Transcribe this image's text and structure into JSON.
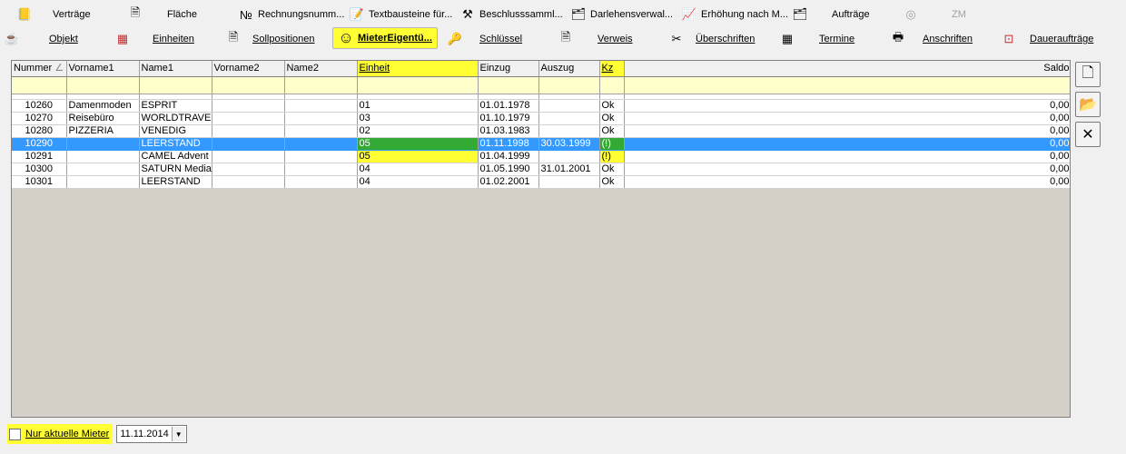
{
  "toolbar": {
    "row1": [
      {
        "label": "Verträge",
        "icon": "contract-icon",
        "glyph": "📒"
      },
      {
        "label": "Fläche",
        "icon": "area-icon",
        "glyph": "🗎"
      },
      {
        "label": "Rechnungsnumm...",
        "icon": "invoice-number-icon",
        "glyph": "№"
      },
      {
        "label": "Textbausteine für...",
        "icon": "text-blocks-icon",
        "glyph": "📝"
      },
      {
        "label": "Beschlusssamml...",
        "icon": "resolutions-icon",
        "glyph": "⚒"
      },
      {
        "label": "Darlehensverwal...",
        "icon": "loan-icon",
        "glyph": "🗂"
      },
      {
        "label": "Erhöhung nach M...",
        "icon": "increase-chart-icon",
        "glyph": "📈"
      },
      {
        "label": "Aufträge",
        "icon": "orders-icon",
        "glyph": "🗂"
      },
      {
        "label": "ZM",
        "icon": "zm-icon",
        "glyph": "◎"
      }
    ],
    "row2": [
      {
        "label": "Objekt",
        "icon": "object-icon",
        "glyph": "☕"
      },
      {
        "label": "Einheiten",
        "icon": "units-icon",
        "glyph": "▦"
      },
      {
        "label": "Sollpositionen",
        "icon": "target-positions-icon",
        "glyph": "🗎"
      },
      {
        "label": "MieterEigentü...",
        "icon": "smiley-icon",
        "glyph": "☺"
      },
      {
        "label": "Schlüssel",
        "icon": "keys-icon",
        "glyph": "🔑"
      },
      {
        "label": "Verweis",
        "icon": "reference-icon",
        "glyph": "🗎"
      },
      {
        "label": "Überschriften",
        "icon": "headings-icon",
        "glyph": "✂"
      },
      {
        "label": "Termine",
        "icon": "calendar-icon",
        "glyph": "▦"
      },
      {
        "label": "Anschriften",
        "icon": "addresses-icon",
        "glyph": "🖶"
      },
      {
        "label": "Daueraufträge",
        "icon": "standing-orders-icon",
        "glyph": "⊡"
      }
    ]
  },
  "grid": {
    "columns": [
      "Nummer",
      "Vorname1",
      "Name1",
      "Vorname2",
      "Name2",
      "Einheit",
      "Einzug",
      "Auszug",
      "Kz",
      "Saldo"
    ],
    "rows": [
      [
        "10260",
        "Damenmoden",
        "ESPRIT",
        "",
        "",
        "01",
        "01.01.1978",
        "",
        "Ok",
        "0,00"
      ],
      [
        "10270",
        "Reisebüro",
        "WORLDTRAVE",
        "",
        "",
        "03",
        "01.10.1979",
        "",
        "Ok",
        "0,00"
      ],
      [
        "10280",
        "PIZZERIA",
        "VENEDIG",
        "",
        "",
        "02",
        "01.03.1983",
        "",
        "Ok",
        "0,00"
      ],
      [
        "10290",
        "",
        "LEERSTAND",
        "",
        "",
        "05",
        "01.11.1998",
        "30.03.1999",
        "(!)",
        "0,00"
      ],
      [
        "10291",
        "",
        "CAMEL Advent",
        "",
        "",
        "05",
        "01.04.1999",
        "",
        "(!)",
        "0,00"
      ],
      [
        "10300",
        "",
        "SATURN Media",
        "",
        "",
        "04",
        "01.05.1990",
        "31.01.2001",
        "Ok",
        "0,00"
      ],
      [
        "10301",
        "",
        "LEERSTAND",
        "",
        "",
        "04",
        "01.02.2001",
        "",
        "Ok",
        "0,00"
      ]
    ],
    "selected_row_index": 3
  },
  "side_buttons": [
    {
      "icon": "new-document-icon",
      "glyph": "🗋"
    },
    {
      "icon": "open-folder-icon",
      "glyph": "📂"
    },
    {
      "icon": "delete-x-icon",
      "glyph": "✕"
    }
  ],
  "footer": {
    "checkbox_label": "Nur aktuelle Mieter",
    "checkbox_checked": false,
    "date_value": "11.11.2014"
  },
  "colors": {
    "highlight": "#ffff33",
    "selection": "#3399ff",
    "green_highlight": "#33aa33"
  }
}
